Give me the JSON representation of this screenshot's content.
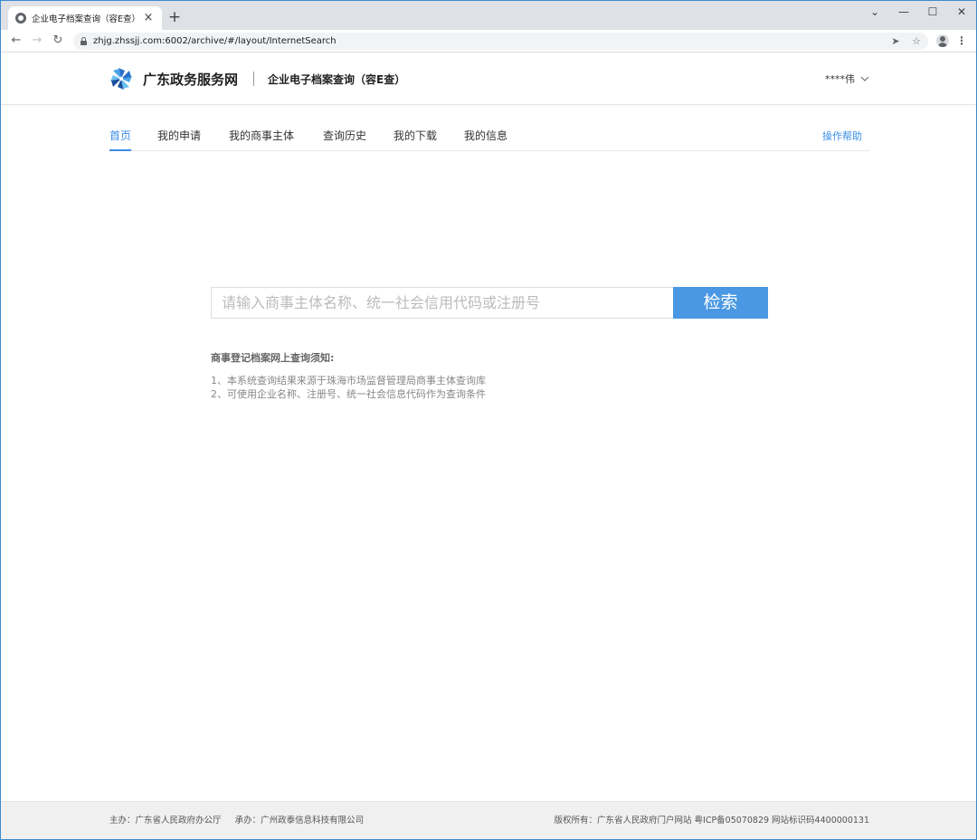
{
  "browser": {
    "tab_title": "企业电子档案查询（容E查）",
    "tab_close": "×",
    "new_tab": "+",
    "url": "zhjg.zhssjj.com:6002/archive/#/layout/InternetSearch",
    "window_controls": {
      "minimize": "—",
      "maximize": "☐",
      "close": "✕",
      "tab_search": "⌄"
    }
  },
  "header": {
    "site_name": "广东政务服务网",
    "sub_title": "企业电子档案查询（容E查）",
    "user_name": "****伟",
    "logo_colors": [
      "#2a6fc9",
      "#4aa3e8",
      "#1b4f9c",
      "#6cc0f0"
    ]
  },
  "nav": {
    "tabs": [
      {
        "label": "首页",
        "active": true
      },
      {
        "label": "我的申请",
        "active": false
      },
      {
        "label": "我的商事主体",
        "active": false
      },
      {
        "label": "查询历史",
        "active": false
      },
      {
        "label": "我的下载",
        "active": false
      },
      {
        "label": "我的信息",
        "active": false
      }
    ],
    "help_label": "操作帮助"
  },
  "search": {
    "placeholder": "请输入商事主体名称、统一社会信用代码或注册号",
    "value": "",
    "button_label": "检索"
  },
  "notice": {
    "title": "商事登记档案网上查询须知:",
    "lines": [
      "1、本系统查询结果来源于珠海市场监督管理局商事主体查询库",
      "2、可使用企业名称、注册号、统一社会信息代码作为查询条件"
    ]
  },
  "footer": {
    "left": "主办：广东省人民政府办公厅     承办：广州政泰信息科技有限公司",
    "right": "版权所有：广东省人民政府门户网站 粤ICP备05070829 网站标识码4400000131"
  },
  "colors": {
    "accent": "#3a8ee6",
    "button": "#4a98e3",
    "frame": "#3d8bd0"
  }
}
